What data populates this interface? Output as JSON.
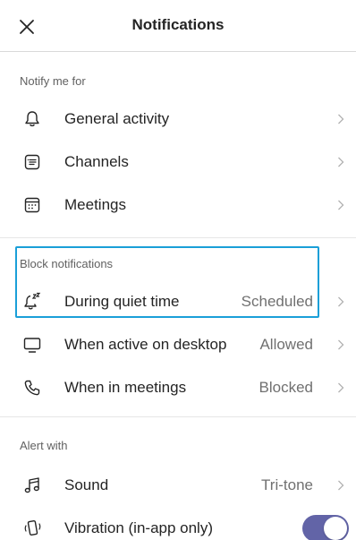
{
  "header": {
    "title": "Notifications"
  },
  "sections": {
    "notify": {
      "label": "Notify me for",
      "items": [
        {
          "label": "General activity",
          "icon": "bell-icon"
        },
        {
          "label": "Channels",
          "icon": "channels-icon"
        },
        {
          "label": "Meetings",
          "icon": "calendar-icon"
        }
      ]
    },
    "block": {
      "label": "Block notifications",
      "items": [
        {
          "label": "During quiet time",
          "value": "Scheduled",
          "icon": "bell-snooze-icon"
        },
        {
          "label": "When active on desktop",
          "value": "Allowed",
          "icon": "desktop-icon"
        },
        {
          "label": "When in meetings",
          "value": "Blocked",
          "icon": "phone-icon"
        }
      ]
    },
    "alert": {
      "label": "Alert with",
      "items": [
        {
          "label": "Sound",
          "value": "Tri-tone",
          "icon": "music-note-icon"
        },
        {
          "label": "Vibration (in-app only)",
          "toggle": true,
          "icon": "vibration-icon"
        }
      ]
    }
  },
  "colors": {
    "highlight": "#1a9fd8",
    "toggle_on": "#6264a7"
  }
}
